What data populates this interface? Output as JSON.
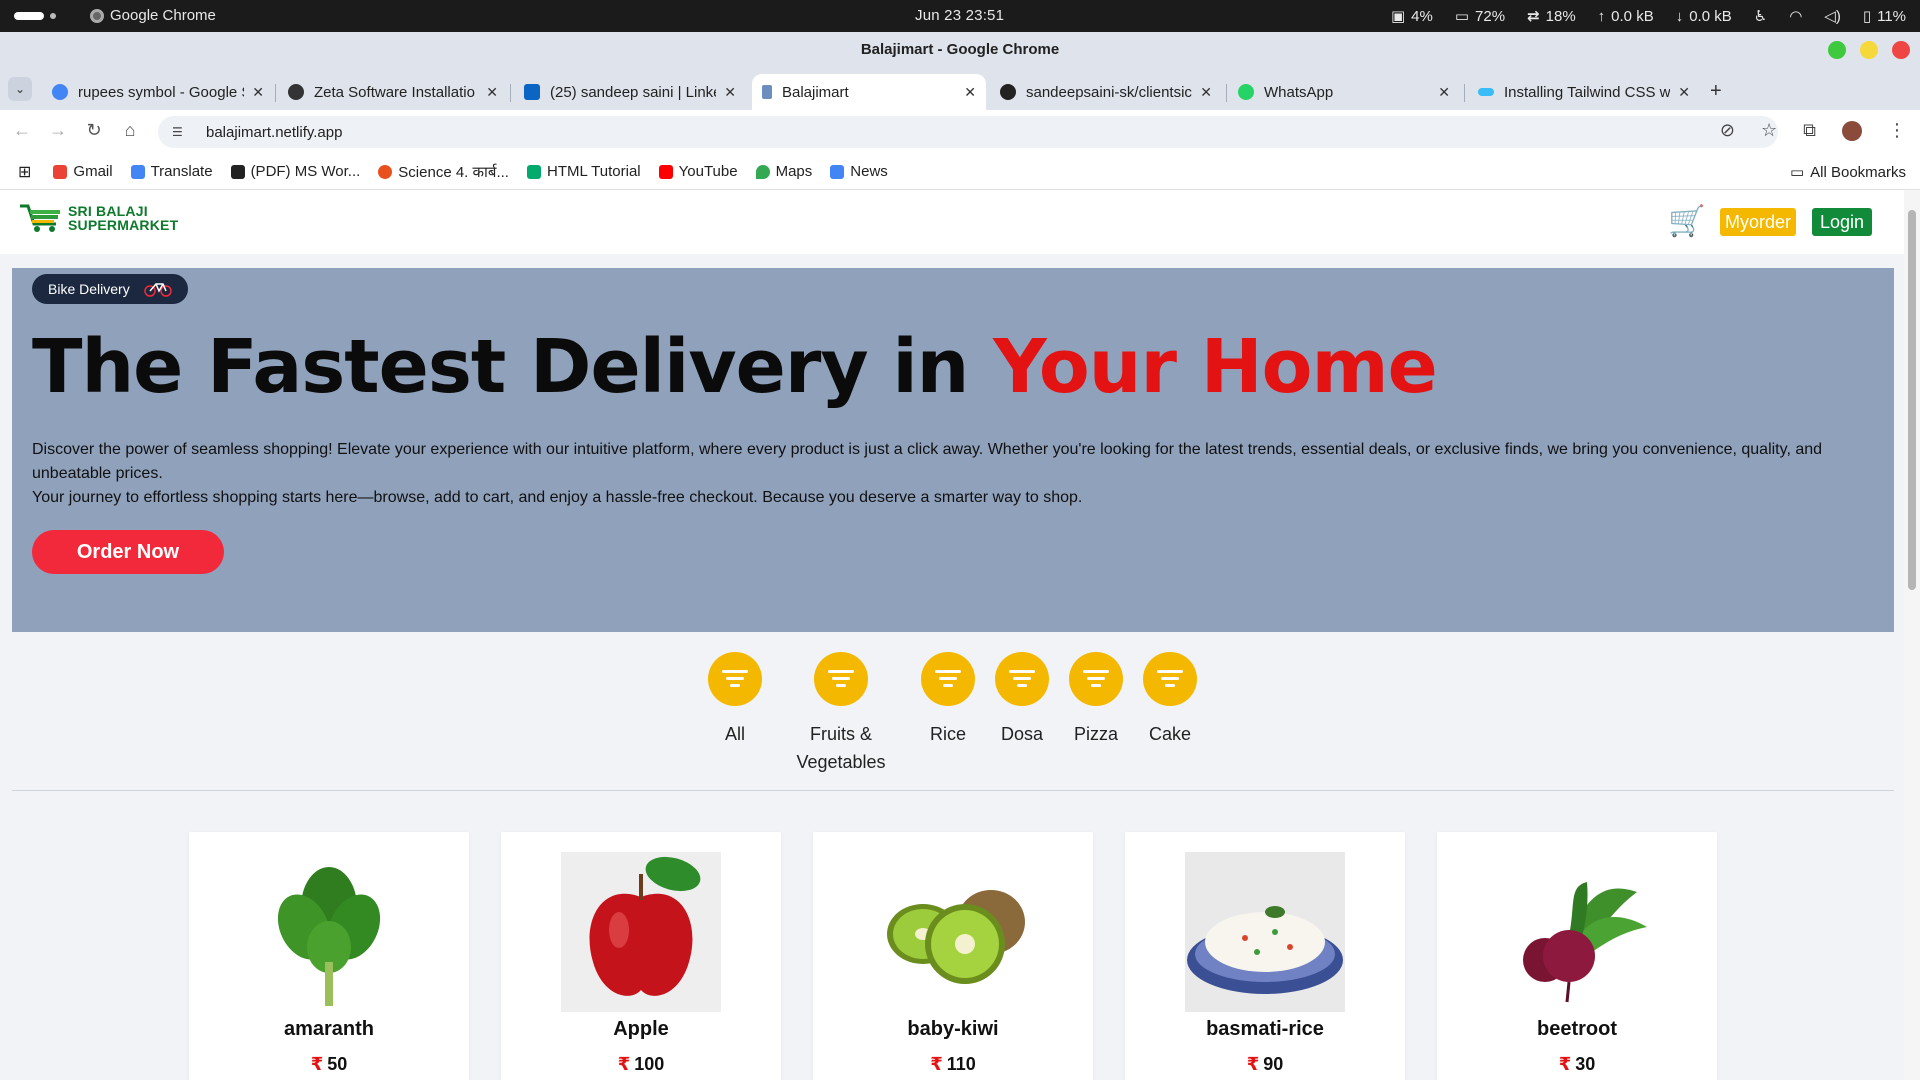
{
  "os": {
    "app_name": "Google Chrome",
    "clock": "Jun 23  23:51",
    "stats": [
      "4%",
      "72%",
      "18%",
      "0.0 kB",
      "0.0 kB",
      "11%"
    ]
  },
  "window": {
    "title": "Balajimart - Google Chrome"
  },
  "tabs": [
    {
      "label": "rupees symbol - Google S",
      "color": "#4285f4"
    },
    {
      "label": "Zeta Software Installatio",
      "color": "#333333"
    },
    {
      "label": "(25) sandeep saini | Linke",
      "color": "#0a66c2"
    },
    {
      "label": "Balajimart",
      "color": "#6c8ebf"
    },
    {
      "label": "sandeepsaini-sk/clientsic",
      "color": "#222222"
    },
    {
      "label": "WhatsApp",
      "color": "#25d366"
    },
    {
      "label": "Installing Tailwind CSS w",
      "color": "#38bdf8"
    }
  ],
  "address": {
    "url": "balajimart.netlify.app"
  },
  "bookmarks": [
    {
      "label": "Gmail",
      "color": "#ea4335"
    },
    {
      "label": "Translate",
      "color": "#4285f4"
    },
    {
      "label": "(PDF) MS Wor...",
      "color": "#222222"
    },
    {
      "label": "Science 4. कार्ब...",
      "color": "#e8501d"
    },
    {
      "label": "HTML Tutorial",
      "color": "#04aa6d"
    },
    {
      "label": "YouTube",
      "color": "#ff0000"
    },
    {
      "label": "Maps",
      "color": "#34a853"
    },
    {
      "label": "News",
      "color": "#4285f4"
    }
  ],
  "all_bookmarks": "All Bookmarks",
  "site": {
    "logo_line1": "SRI BALAJI",
    "logo_line2": "SUPERMARKET",
    "myorder": "Myorder",
    "login": "Login",
    "badge": "Bike Delivery",
    "hero_title_a": "The Fastest Delivery in ",
    "hero_title_b": "Your Home",
    "hero_desc_1": "Discover the power of seamless shopping! Elevate your experience with our intuitive platform, where every product is just a click away. Whether you're looking for the latest trends, essential deals, or exclusive finds, we bring you convenience, quality, and unbeatable prices.",
    "hero_desc_2": "Your journey to effortless shopping starts here—browse, add to cart, and enjoy a hassle-free checkout. Because you deserve a smarter way to shop.",
    "order_now": "Order Now",
    "categories": [
      "All",
      "Fruits & Vegetables",
      "Rice",
      "Dosa",
      "Pizza",
      "Cake"
    ],
    "currency": "₹",
    "products": [
      {
        "name": "amaranth",
        "price": "50"
      },
      {
        "name": "Apple",
        "price": "100"
      },
      {
        "name": "baby-kiwi",
        "price": "110"
      },
      {
        "name": "basmati-rice",
        "price": "90"
      },
      {
        "name": "beetroot",
        "price": "30"
      }
    ]
  },
  "colors": {
    "hero_bg": "#8fa1bb",
    "accent_red": "#e31313",
    "accent_yellow": "#f5b800",
    "login_green": "#118a3a"
  }
}
